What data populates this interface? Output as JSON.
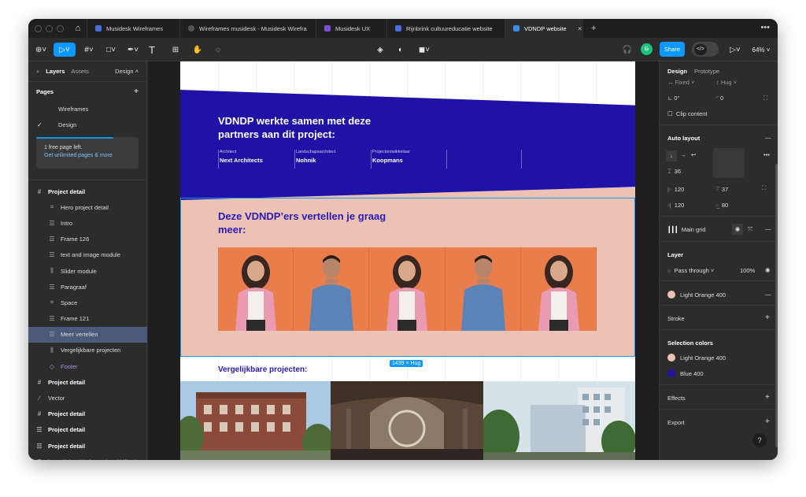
{
  "tabs": [
    {
      "label": "Musidesk Wireframes",
      "active": false
    },
    {
      "label": "Wireframes musidesk - Musidesk Wirefra",
      "active": false
    },
    {
      "label": "Musidesk UX",
      "active": false
    },
    {
      "label": "Rijnbrink cultuureducatie website",
      "active": false
    },
    {
      "label": "VDNDP website",
      "active": true
    }
  ],
  "toolbar": {
    "avatar_initial": "G",
    "share_label": "Share",
    "dev_mode_glyph": "</>",
    "zoom": "64%"
  },
  "left_panel": {
    "tab_layers": "Layers",
    "tab_assets": "Assets",
    "design_dropdown": "Design",
    "pages_title": "Pages",
    "pages": [
      {
        "label": "Wireframes",
        "current": false
      },
      {
        "label": "Design",
        "current": true
      }
    ],
    "promo_text": "1 free page left.",
    "promo_link": "Get unlimited pages & more",
    "layers": [
      {
        "label": "Project detail",
        "level": "top",
        "icon": "frame-icon"
      },
      {
        "label": "Hero project detail",
        "level": "sub",
        "icon": "grid-frame-icon"
      },
      {
        "label": "Intro",
        "level": "sub",
        "icon": "auto-layout-icon"
      },
      {
        "label": "Frame 126",
        "level": "sub",
        "icon": "auto-layout-icon"
      },
      {
        "label": "text and image module",
        "level": "sub",
        "icon": "auto-layout-icon"
      },
      {
        "label": "Slider module",
        "level": "sub",
        "icon": "horizontal-layout-icon"
      },
      {
        "label": "Paragraaf",
        "level": "sub",
        "icon": "auto-layout-icon"
      },
      {
        "label": "Space",
        "level": "sub",
        "icon": "grid-frame-icon"
      },
      {
        "label": "Frame 121",
        "level": "sub",
        "icon": "auto-layout-icon"
      },
      {
        "label": "Meer vertellen",
        "level": "sub",
        "icon": "auto-layout-icon",
        "highlighted": true
      },
      {
        "label": "Vergelijkbare projecten",
        "level": "sub",
        "icon": "horizontal-layout-icon"
      },
      {
        "label": "Footer",
        "level": "sub",
        "icon": "component-icon",
        "purple": true
      },
      {
        "label": "Project detail",
        "level": "top",
        "icon": "frame-icon"
      },
      {
        "label": "Vector",
        "level": "top-plain",
        "icon": "vector-icon"
      },
      {
        "label": "Project detail",
        "level": "top",
        "icon": "frame-icon"
      },
      {
        "label": "Project detail",
        "level": "top",
        "icon": "auto-layout-icon"
      },
      {
        "label": "Project detail",
        "level": "top",
        "icon": "auto-layout-icon"
      },
      {
        "label": "https://gist.github.com/markhillard...",
        "level": "top-plain",
        "icon": "text-icon"
      }
    ]
  },
  "canvas": {
    "heading_partners": "VDNDP werkte samen met deze partners aan dit project:",
    "partners": [
      {
        "role": "Architect",
        "name": "Next Architects"
      },
      {
        "role": "Landschapsarchitect",
        "name": "Nohnik"
      },
      {
        "role": "Projectontwikkelaar",
        "name": "Koopmans"
      },
      {
        "role": "",
        "name": ""
      },
      {
        "role": "",
        "name": ""
      }
    ],
    "heading_meer": "Deze VDNDP’ers vertellen je graag meer:",
    "photos": [
      "woman",
      "man",
      "woman",
      "man",
      "woman"
    ],
    "dimension_tag": "1439 × Hug",
    "heading_vergelijkbaar": "Vergelijkbare projecten:",
    "colors": {
      "blue": "#1f12a6",
      "peach": "#ecc2b4",
      "orange": "#e97e4c",
      "selection": "#0d99ff"
    }
  },
  "right_panel": {
    "tab_design": "Design",
    "tab_prototype": "Prototype",
    "width_mode": "Fixed",
    "height_mode": "Hug",
    "rotation": "0°",
    "corner_radius": "0",
    "clip_content": "Clip content",
    "auto_layout_title": "Auto layout",
    "gap": "36",
    "padding_left": "120",
    "padding_top": "37",
    "padding_right": "120",
    "padding_bottom": "80",
    "layout_grid_name": "Main grid",
    "layer_title": "Layer",
    "blend_mode": "Pass through",
    "opacity": "100%",
    "fill_name": "Light Orange 400",
    "fill_color": "#edc3b5",
    "stroke_title": "Stroke",
    "selection_colors_title": "Selection colors",
    "selection_colors": [
      {
        "name": "Light Orange 400",
        "color": "#edc3b5"
      },
      {
        "name": "Blue 400",
        "color": "#1f12a6"
      }
    ],
    "effects_title": "Effects",
    "export_title": "Export",
    "help": "?"
  }
}
